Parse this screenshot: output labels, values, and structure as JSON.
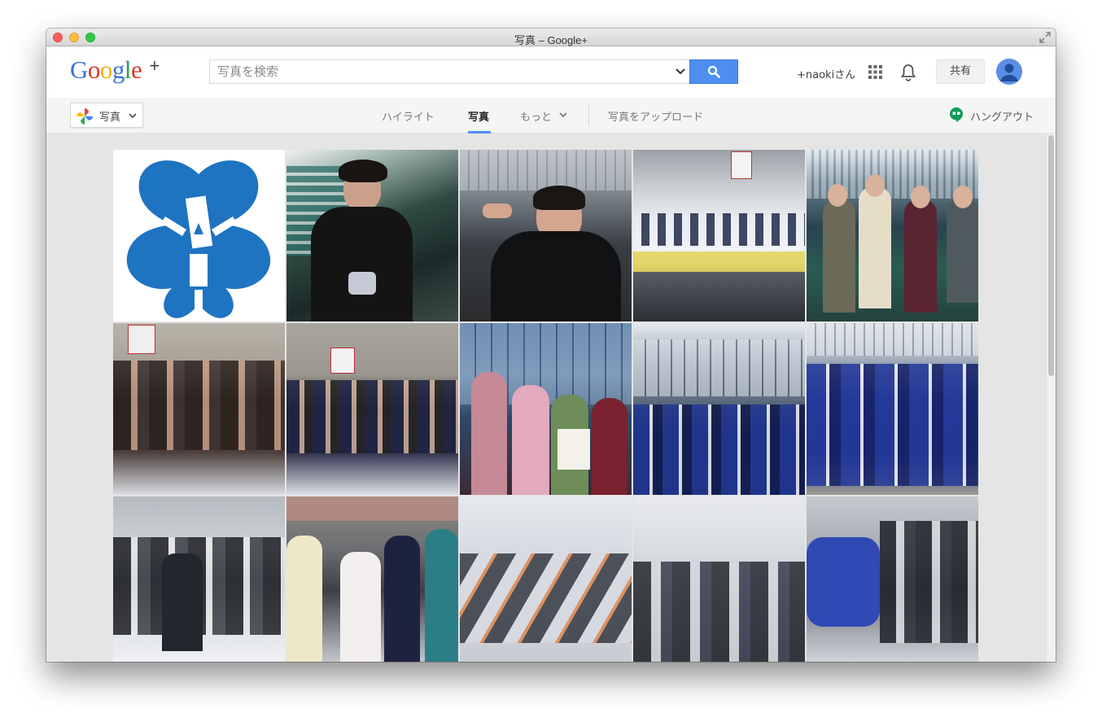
{
  "window": {
    "title": "写真 – Google+"
  },
  "header": {
    "logo_text": "Google",
    "logo_plus": "+",
    "search": {
      "placeholder": "写真を検索",
      "value": ""
    },
    "user_name": "+naokiさん",
    "share_label": "共有"
  },
  "subnav": {
    "photos_dropdown_label": "写真",
    "tabs": [
      {
        "label": "ハイライト",
        "active": false
      },
      {
        "label": "写真",
        "active": true
      },
      {
        "label": "もっと",
        "active": false
      },
      {
        "label": "写真をアップロード",
        "active": false
      }
    ],
    "hangouts_label": "ハングアウト"
  },
  "colors": {
    "accent": "#4d8ef0",
    "hangouts_green": "#0f9d58",
    "crest_blue": "#1e74c1"
  },
  "photos": [
    {
      "kind": "crest-logo",
      "bg": "#ffffff"
    },
    {
      "kind": "ice-rink-stairs",
      "bg": "#3b4a45"
    },
    {
      "kind": "ice-rink-selfie",
      "bg": "#4a4f55"
    },
    {
      "kind": "team-lineup-ice",
      "bg": "#d8dbe0"
    },
    {
      "kind": "group-indoor",
      "bg": "#2a3d4a"
    },
    {
      "kind": "group-on-ice",
      "bg": "#8a8680"
    },
    {
      "kind": "team-group-ice",
      "bg": "#6c6a6e"
    },
    {
      "kind": "kimono-graduation",
      "bg": "#3e5d82"
    },
    {
      "kind": "team-jerseys-outdoor",
      "bg": "#4a5a8a"
    },
    {
      "kind": "team-jerseys-group",
      "bg": "#3f5687"
    },
    {
      "kind": "hockey-goalie",
      "bg": "#9a9ea4"
    },
    {
      "kind": "group-rink-side",
      "bg": "#6c7075"
    },
    {
      "kind": "lying-on-ice",
      "bg": "#c9ccd2"
    },
    {
      "kind": "group-sitting-ice",
      "bg": "#b9bcc2"
    },
    {
      "kind": "group-posing-ice",
      "bg": "#8d8f94"
    }
  ]
}
